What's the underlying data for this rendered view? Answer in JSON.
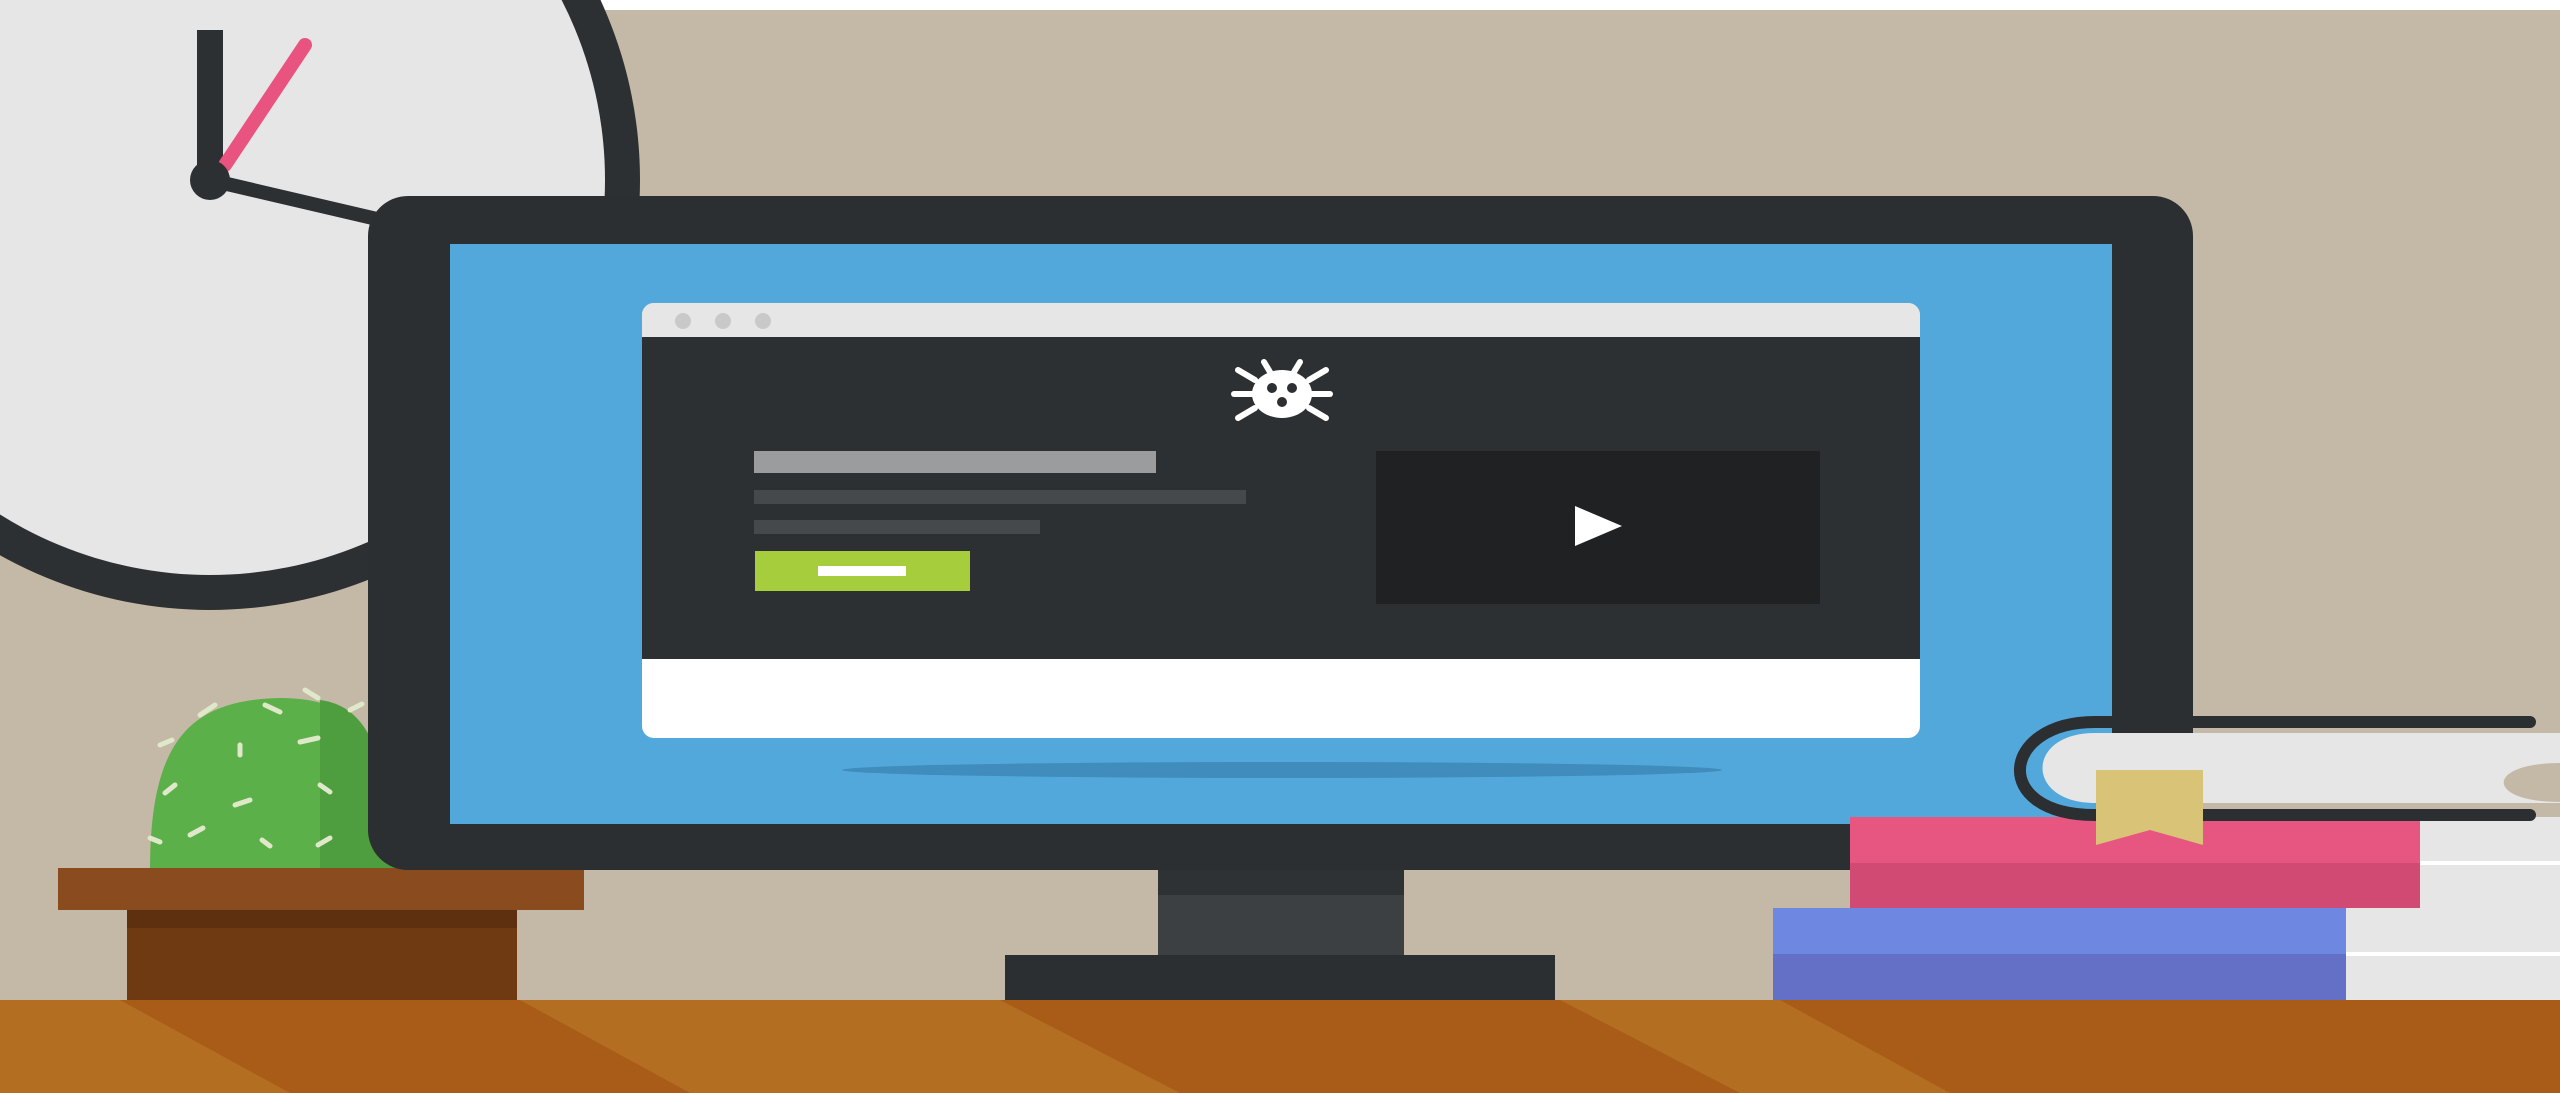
{
  "scene": {
    "subject": "flat-illustration",
    "colors": {
      "wall": "#c4b8a6",
      "desk": "#b36e22",
      "desk_dark": "#a95b18",
      "monitor_frame": "#2b2f31",
      "screen_blue": "#52a8db",
      "window_body": "#2d3033",
      "window_titlebar": "#e6e6e6",
      "accent_green": "#a6cd3c",
      "clock_face": "#e6e6e6",
      "clock_second_hand": "#e8537f",
      "cactus": "#5bb04a",
      "pot": "#8a4b1e",
      "book_pink": "#e65680",
      "book_blue": "#6e87e0",
      "bookmark": "#d9c376"
    }
  },
  "monitor": {
    "browser_window": {
      "titlebar_dots": 3,
      "logo_icon": "bug-icon",
      "text_placeholder_lines": 3,
      "cta_button_icon": "dash-glyph",
      "video_play_icon": "play-icon"
    }
  }
}
